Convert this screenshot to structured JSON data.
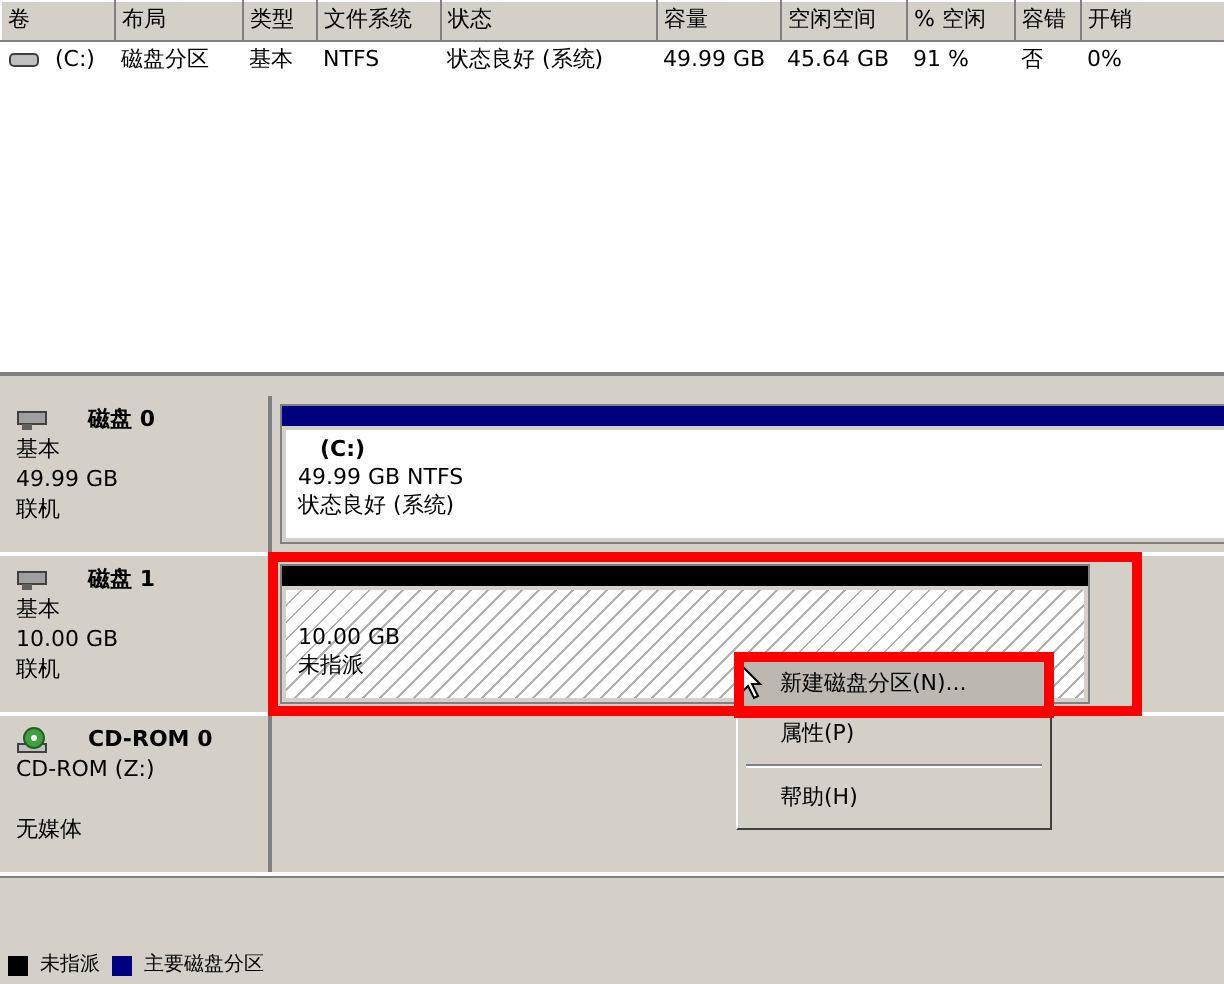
{
  "volume_list": {
    "columns": [
      "卷",
      "布局",
      "类型",
      "文件系统",
      "状态",
      "容量",
      "空闲空间",
      "% 空闲",
      "容错",
      "开销"
    ],
    "rows": [
      {
        "cells": [
          "(C:)",
          "磁盘分区",
          "基本",
          "NTFS",
          "状态良好 (系统)",
          "49.99 GB",
          "45.64 GB",
          "91 %",
          "否",
          "0%"
        ]
      }
    ]
  },
  "disks": [
    {
      "kind": "disk",
      "name": "磁盘 0",
      "lines": [
        "基本",
        "49.99 GB",
        "联机"
      ],
      "partitions": [
        {
          "kind": "primary",
          "label": "(C:)",
          "lines": [
            "49.99 GB NTFS",
            "状态良好 (系统)"
          ],
          "highlight": false
        }
      ]
    },
    {
      "kind": "disk",
      "name": "磁盘 1",
      "lines": [
        "基本",
        "10.00 GB",
        "联机"
      ],
      "partitions": [
        {
          "kind": "unallocated",
          "lines": [
            "10.00 GB",
            "未指派"
          ],
          "highlight": true
        }
      ]
    },
    {
      "kind": "cdrom",
      "name": "CD-ROM 0",
      "lines": [
        "CD-ROM (Z:)",
        "无媒体"
      ]
    }
  ],
  "context_menu": {
    "items": [
      {
        "kind": "item",
        "label": "新建磁盘分区(N)...",
        "selected": true,
        "highlight": true
      },
      {
        "kind": "item",
        "label": "属性(P)",
        "selected": false,
        "highlight": false
      },
      {
        "kind": "separator"
      },
      {
        "kind": "item",
        "label": "帮助(H)",
        "selected": false,
        "highlight": false
      }
    ]
  },
  "legend": [
    {
      "label": "未指派",
      "color": "#000000"
    },
    {
      "label": "主要磁盘分区",
      "color": "#000080"
    }
  ]
}
